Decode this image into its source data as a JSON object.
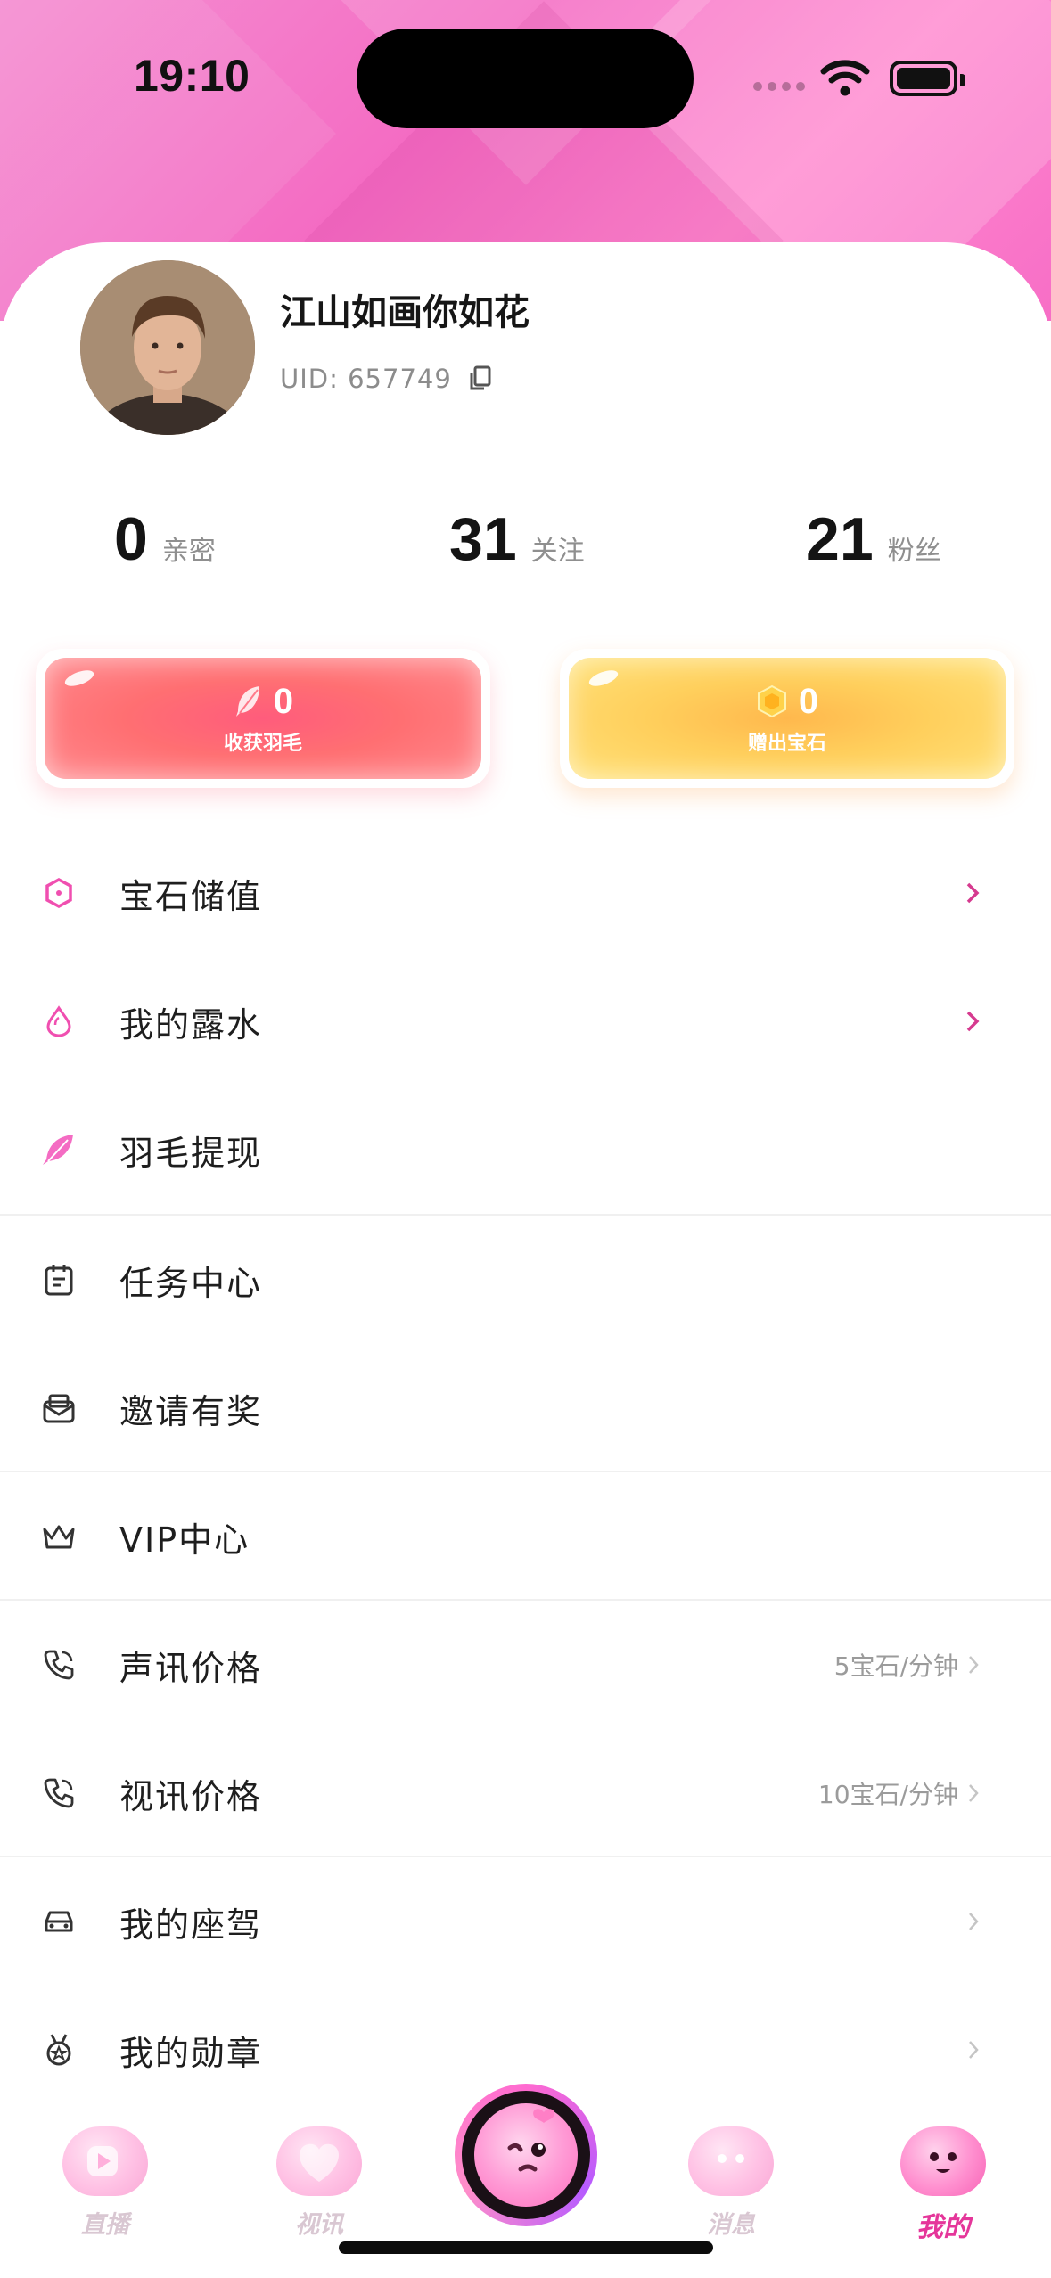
{
  "status": {
    "time": "19:10"
  },
  "profile": {
    "nickname": "江山如画你如花",
    "uid_label": "UID:",
    "uid": "657749"
  },
  "stats": [
    {
      "value": "0",
      "label": "亲密"
    },
    {
      "value": "31",
      "label": "关注"
    },
    {
      "value": "21",
      "label": "粉丝"
    }
  ],
  "wallet": {
    "feathers": {
      "value": "0",
      "caption": "收获羽毛"
    },
    "gems": {
      "value": "0",
      "caption": "赠出宝石"
    }
  },
  "menu": [
    {
      "label": "宝石储值",
      "icon": "hexagon-gem-icon"
    },
    {
      "label": "我的露水",
      "icon": "water-drop-icon"
    },
    {
      "label": "羽毛提现",
      "icon": "feather-icon"
    },
    {
      "label": "任务中心",
      "icon": "task-clipboard-icon"
    },
    {
      "label": "邀请有奖",
      "icon": "invite-envelope-icon"
    },
    {
      "label": "VIP中心",
      "icon": "crown-icon"
    },
    {
      "label": "声讯价格",
      "icon": "phone-icon",
      "value": "5宝石/分钟"
    },
    {
      "label": "视讯价格",
      "icon": "phone-icon",
      "value": "10宝石/分钟"
    },
    {
      "label": "我的座驾",
      "icon": "car-icon"
    },
    {
      "label": "我的勋章",
      "icon": "medal-icon"
    }
  ],
  "tabs": [
    {
      "label": "直播"
    },
    {
      "label": "视讯"
    },
    {
      "label": "消息"
    },
    {
      "label": "我的"
    }
  ],
  "colors": {
    "accent": "#e5369a",
    "menu_chevron_pink": "#d63a8f",
    "hero_pink": "#f46cc3"
  }
}
